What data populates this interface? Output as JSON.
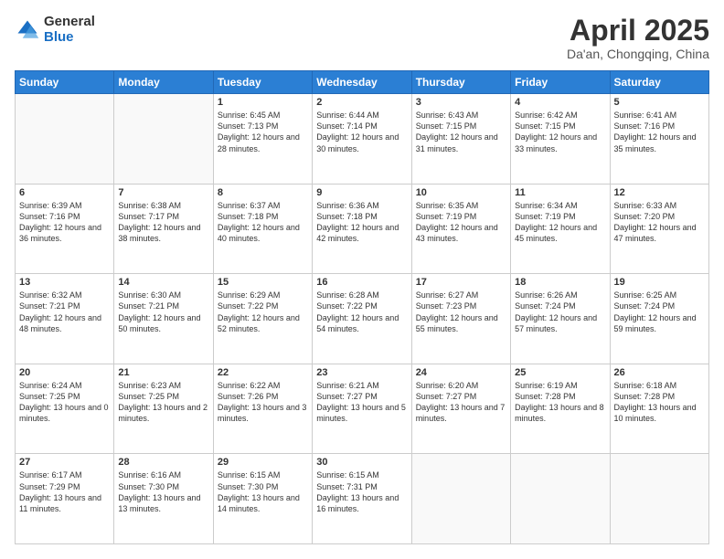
{
  "header": {
    "logo_general": "General",
    "logo_blue": "Blue",
    "title": "April 2025",
    "location": "Da'an, Chongqing, China"
  },
  "days_of_week": [
    "Sunday",
    "Monday",
    "Tuesday",
    "Wednesday",
    "Thursday",
    "Friday",
    "Saturday"
  ],
  "weeks": [
    [
      {
        "num": "",
        "info": ""
      },
      {
        "num": "",
        "info": ""
      },
      {
        "num": "1",
        "info": "Sunrise: 6:45 AM\nSunset: 7:13 PM\nDaylight: 12 hours and 28 minutes."
      },
      {
        "num": "2",
        "info": "Sunrise: 6:44 AM\nSunset: 7:14 PM\nDaylight: 12 hours and 30 minutes."
      },
      {
        "num": "3",
        "info": "Sunrise: 6:43 AM\nSunset: 7:15 PM\nDaylight: 12 hours and 31 minutes."
      },
      {
        "num": "4",
        "info": "Sunrise: 6:42 AM\nSunset: 7:15 PM\nDaylight: 12 hours and 33 minutes."
      },
      {
        "num": "5",
        "info": "Sunrise: 6:41 AM\nSunset: 7:16 PM\nDaylight: 12 hours and 35 minutes."
      }
    ],
    [
      {
        "num": "6",
        "info": "Sunrise: 6:39 AM\nSunset: 7:16 PM\nDaylight: 12 hours and 36 minutes."
      },
      {
        "num": "7",
        "info": "Sunrise: 6:38 AM\nSunset: 7:17 PM\nDaylight: 12 hours and 38 minutes."
      },
      {
        "num": "8",
        "info": "Sunrise: 6:37 AM\nSunset: 7:18 PM\nDaylight: 12 hours and 40 minutes."
      },
      {
        "num": "9",
        "info": "Sunrise: 6:36 AM\nSunset: 7:18 PM\nDaylight: 12 hours and 42 minutes."
      },
      {
        "num": "10",
        "info": "Sunrise: 6:35 AM\nSunset: 7:19 PM\nDaylight: 12 hours and 43 minutes."
      },
      {
        "num": "11",
        "info": "Sunrise: 6:34 AM\nSunset: 7:19 PM\nDaylight: 12 hours and 45 minutes."
      },
      {
        "num": "12",
        "info": "Sunrise: 6:33 AM\nSunset: 7:20 PM\nDaylight: 12 hours and 47 minutes."
      }
    ],
    [
      {
        "num": "13",
        "info": "Sunrise: 6:32 AM\nSunset: 7:21 PM\nDaylight: 12 hours and 48 minutes."
      },
      {
        "num": "14",
        "info": "Sunrise: 6:30 AM\nSunset: 7:21 PM\nDaylight: 12 hours and 50 minutes."
      },
      {
        "num": "15",
        "info": "Sunrise: 6:29 AM\nSunset: 7:22 PM\nDaylight: 12 hours and 52 minutes."
      },
      {
        "num": "16",
        "info": "Sunrise: 6:28 AM\nSunset: 7:22 PM\nDaylight: 12 hours and 54 minutes."
      },
      {
        "num": "17",
        "info": "Sunrise: 6:27 AM\nSunset: 7:23 PM\nDaylight: 12 hours and 55 minutes."
      },
      {
        "num": "18",
        "info": "Sunrise: 6:26 AM\nSunset: 7:24 PM\nDaylight: 12 hours and 57 minutes."
      },
      {
        "num": "19",
        "info": "Sunrise: 6:25 AM\nSunset: 7:24 PM\nDaylight: 12 hours and 59 minutes."
      }
    ],
    [
      {
        "num": "20",
        "info": "Sunrise: 6:24 AM\nSunset: 7:25 PM\nDaylight: 13 hours and 0 minutes."
      },
      {
        "num": "21",
        "info": "Sunrise: 6:23 AM\nSunset: 7:25 PM\nDaylight: 13 hours and 2 minutes."
      },
      {
        "num": "22",
        "info": "Sunrise: 6:22 AM\nSunset: 7:26 PM\nDaylight: 13 hours and 3 minutes."
      },
      {
        "num": "23",
        "info": "Sunrise: 6:21 AM\nSunset: 7:27 PM\nDaylight: 13 hours and 5 minutes."
      },
      {
        "num": "24",
        "info": "Sunrise: 6:20 AM\nSunset: 7:27 PM\nDaylight: 13 hours and 7 minutes."
      },
      {
        "num": "25",
        "info": "Sunrise: 6:19 AM\nSunset: 7:28 PM\nDaylight: 13 hours and 8 minutes."
      },
      {
        "num": "26",
        "info": "Sunrise: 6:18 AM\nSunset: 7:28 PM\nDaylight: 13 hours and 10 minutes."
      }
    ],
    [
      {
        "num": "27",
        "info": "Sunrise: 6:17 AM\nSunset: 7:29 PM\nDaylight: 13 hours and 11 minutes."
      },
      {
        "num": "28",
        "info": "Sunrise: 6:16 AM\nSunset: 7:30 PM\nDaylight: 13 hours and 13 minutes."
      },
      {
        "num": "29",
        "info": "Sunrise: 6:15 AM\nSunset: 7:30 PM\nDaylight: 13 hours and 14 minutes."
      },
      {
        "num": "30",
        "info": "Sunrise: 6:15 AM\nSunset: 7:31 PM\nDaylight: 13 hours and 16 minutes."
      },
      {
        "num": "",
        "info": ""
      },
      {
        "num": "",
        "info": ""
      },
      {
        "num": "",
        "info": ""
      }
    ]
  ]
}
